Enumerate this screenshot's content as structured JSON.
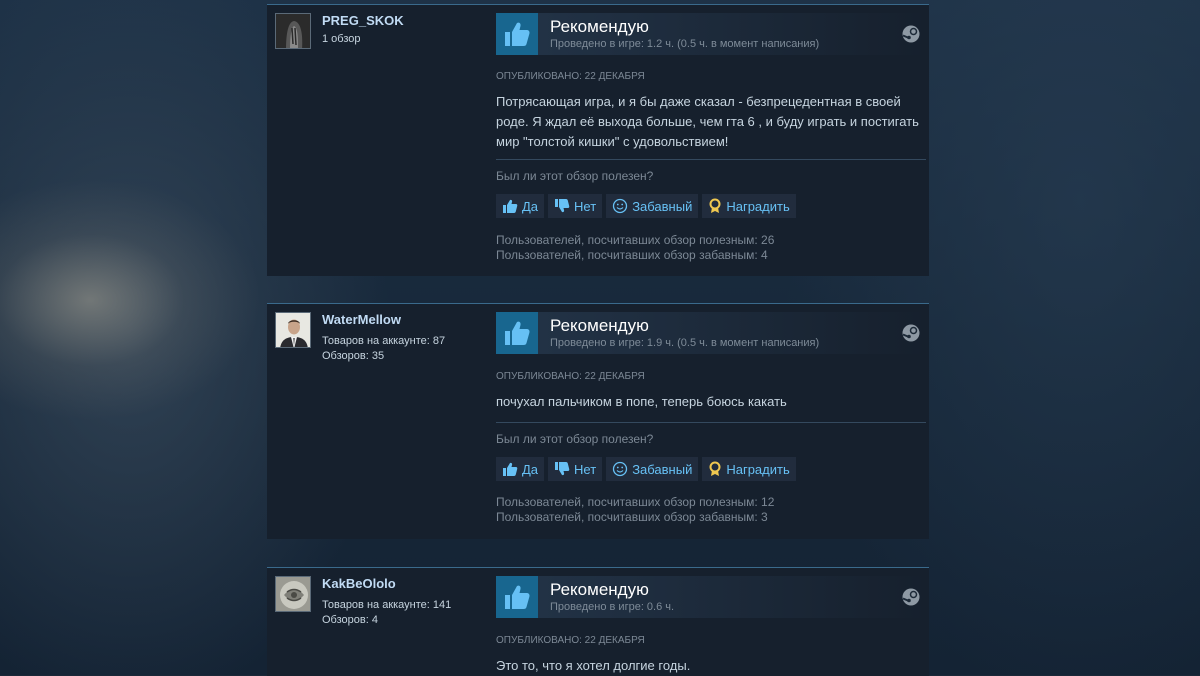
{
  "reviews": [
    {
      "username": "PREG_SKOK",
      "author_stats": [
        "1 обзор"
      ],
      "verdict": "Рекомендую",
      "hours": "Проведено в игре: 1.2 ч. (0.5 ч. в момент написания)",
      "posted": "ОПУБЛИКОВАНО: 22 ДЕКАБРЯ",
      "text": "Потрясающая игра, и я бы даже сказал - безпрецедентная в своей роде. Я ждал её выхода больше, чем гта 6 , и буду играть и постигать мир \"толстой кишки\" с удовольствием!",
      "helpful_question": "Был ли этот обзор полезен?",
      "buttons": {
        "yes": "Да",
        "no": "Нет",
        "funny": "Забавный",
        "award": "Наградить"
      },
      "helpful_count": "Пользователей, посчитавших обзор полезным: 26",
      "funny_count": "Пользователей, посчитавших обзор забавным: 4"
    },
    {
      "username": "WaterMellow",
      "author_stats": [
        "Товаров на аккаунте: 87",
        "Обзоров: 35"
      ],
      "verdict": "Рекомендую",
      "hours": "Проведено в игре: 1.9 ч. (0.5 ч. в момент написания)",
      "posted": "ОПУБЛИКОВАНО: 22 ДЕКАБРЯ",
      "text": "почухал пальчиком в попе, теперь боюсь какать",
      "helpful_question": "Был ли этот обзор полезен?",
      "buttons": {
        "yes": "Да",
        "no": "Нет",
        "funny": "Забавный",
        "award": "Наградить"
      },
      "helpful_count": "Пользователей, посчитавших обзор полезным: 12",
      "funny_count": "Пользователей, посчитавших обзор забавным: 3"
    },
    {
      "username": "KakBeOlolo",
      "author_stats": [
        "Товаров на аккаунте: 141",
        "Обзоров: 4"
      ],
      "verdict": "Рекомендую",
      "hours": "Проведено в игре: 0.6 ч.",
      "posted": "ОПУБЛИКОВАНО: 22 ДЕКАБРЯ",
      "text": "Это то, что я хотел долгие годы."
    }
  ],
  "colors": {
    "accent_link": "#67c1f5",
    "thumb_bg": "#18668f",
    "page_bg": "#1b2838",
    "card_bg": "#16202d",
    "award_gold": "#f0c850"
  },
  "icons": [
    "thumbs-up-icon",
    "thumbs-down-icon",
    "smiley-icon",
    "award-ribbon-icon",
    "steam-logo-icon"
  ]
}
